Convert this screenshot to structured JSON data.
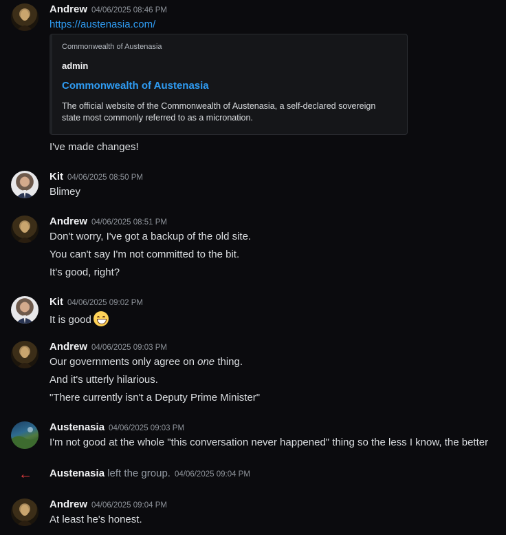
{
  "messages": [
    {
      "author": "Andrew",
      "timestamp": "04/06/2025 08:46 PM",
      "avatar": "andrew-avatar",
      "lines": [
        "https://austenasia.com/",
        "I've made changes!"
      ],
      "embed": {
        "provider": "Commonwealth of Austenasia",
        "author": "admin",
        "title": "Commonwealth of Austenasia",
        "description": "The official website of the Commonwealth of Austenasia, a self-declared sovereign state most commonly referred to as a micronation."
      }
    },
    {
      "author": "Kit",
      "timestamp": "04/06/2025 08:50 PM",
      "avatar": "kit-avatar",
      "lines": [
        "Blimey"
      ]
    },
    {
      "author": "Andrew",
      "timestamp": "04/06/2025 08:51 PM",
      "avatar": "andrew-avatar",
      "lines": [
        "Don't worry, I've got a backup of the old site.",
        "You can't say I'm not committed to the bit.",
        "It's good, right?"
      ]
    },
    {
      "author": "Kit",
      "timestamp": "04/06/2025 09:02 PM",
      "avatar": "kit-avatar",
      "lines": [
        "It is good"
      ],
      "emoji": "grinning-face-emoji"
    },
    {
      "author": "Andrew",
      "timestamp": "04/06/2025 09:03 PM",
      "avatar": "andrew-avatar",
      "lines": [
        "Our governments only agree on ",
        "one",
        " thing.",
        "And it's utterly hilarious.",
        "\"There currently isn't a Deputy Prime Minister\""
      ]
    },
    {
      "author": "Austenasia",
      "timestamp": "04/06/2025 09:03 PM",
      "avatar": "austenasia-avatar",
      "lines": [
        "I'm not good at the whole \"this conversation never happened\" thing so the less I know, the better"
      ]
    },
    {
      "system": true,
      "author": "Austenasia",
      "action": "left the group.",
      "timestamp": "04/06/2025 09:04 PM",
      "icon": "leave-arrow-icon"
    },
    {
      "author": "Andrew",
      "timestamp": "04/06/2025 09:04 PM",
      "avatar": "andrew-avatar",
      "lines": [
        "At least he's honest."
      ]
    }
  ],
  "colors": {
    "background": "#0b0b0e",
    "link": "#2f9cf3",
    "leave_arrow": "#f23f43"
  }
}
